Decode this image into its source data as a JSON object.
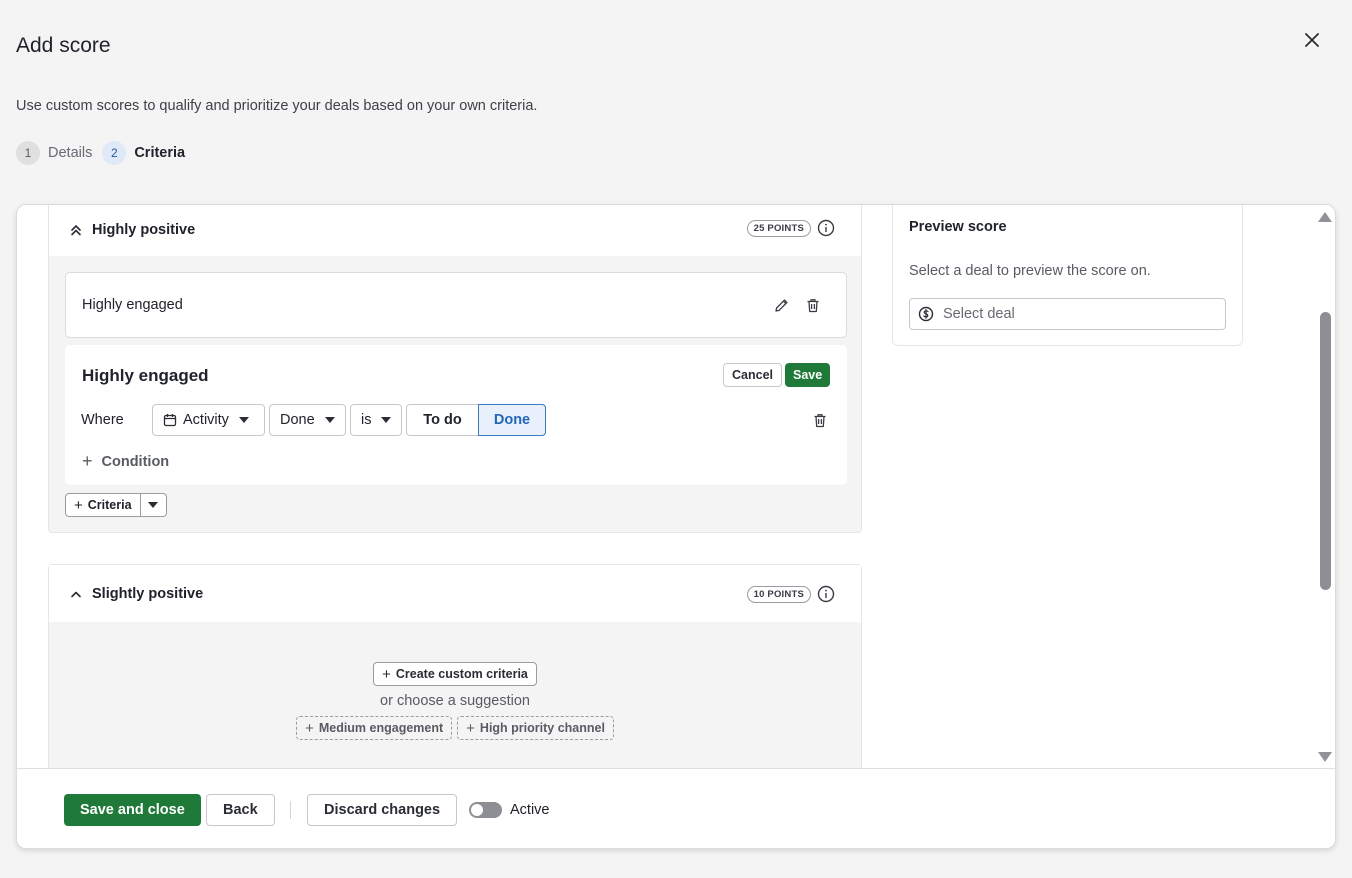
{
  "dialog": {
    "title": "Add score",
    "subtitle": "Use custom scores to qualify and prioritize your deals based on your own criteria."
  },
  "steps": [
    {
      "number": "1",
      "label": "Details"
    },
    {
      "number": "2",
      "label": "Criteria"
    }
  ],
  "groups": {
    "highly_positive": {
      "title": "Highly positive",
      "points": "25 POINTS",
      "criteria_row": {
        "label": "Highly engaged"
      },
      "editor": {
        "title": "Highly engaged",
        "cancel_label": "Cancel",
        "save_label": "Save",
        "where_label": "Where",
        "field_select": "Activity",
        "property_select": "Done",
        "operator_select": "is",
        "segment_options": [
          "To do",
          "Done"
        ],
        "selected_segment": "Done",
        "add_condition_label": "Condition"
      },
      "add_criteria_label": "Criteria"
    },
    "slightly_positive": {
      "title": "Slightly positive",
      "points": "10 POINTS",
      "create_custom_label": "Create custom criteria",
      "or_text": "or choose a suggestion",
      "suggestions": [
        "Medium engagement",
        "High priority channel"
      ]
    }
  },
  "preview": {
    "title": "Preview score",
    "description": "Select a deal to preview the score on.",
    "placeholder": "Select deal"
  },
  "footer": {
    "save_close_label": "Save and close",
    "back_label": "Back",
    "discard_label": "Discard changes",
    "toggle_label": "Active",
    "toggle_on": false
  },
  "colors": {
    "primary_green": "#1f7a39",
    "selected_blue": "#2466b8",
    "background": "#f4f4f4"
  }
}
